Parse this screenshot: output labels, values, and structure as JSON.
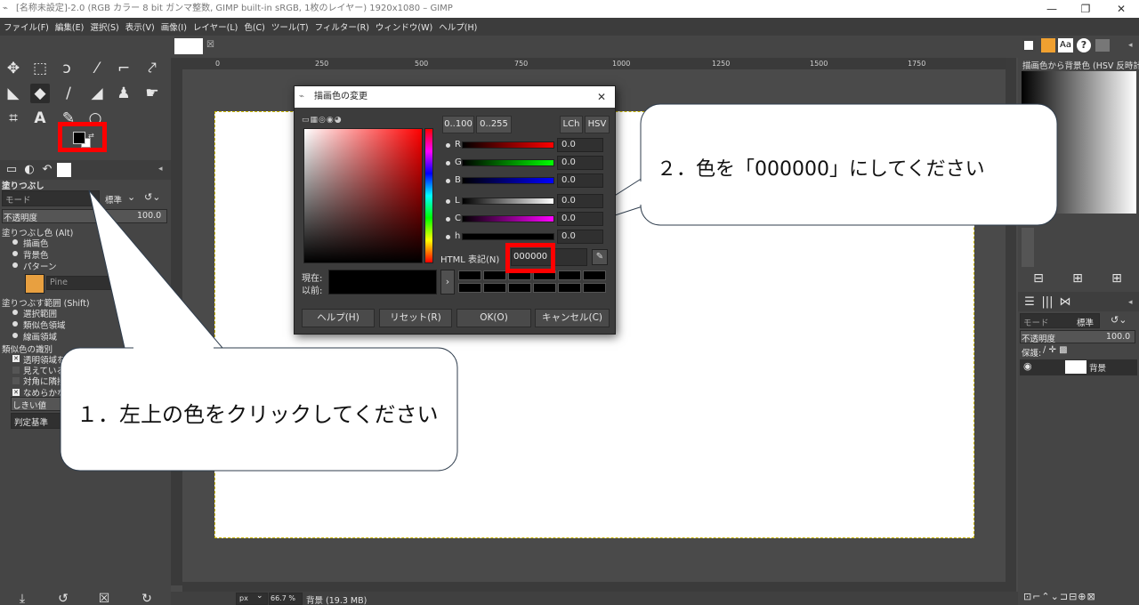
{
  "window": {
    "title": "[名称未設定]-2.0 (RGB カラー 8 bit ガンマ整数, GIMP built-in sRGB, 1枚のレイヤー) 1920x1080 – GIMP",
    "minimize": "—",
    "maximize": "❐",
    "close": "✕"
  },
  "menu": [
    "ファイル(F)",
    "編集(E)",
    "選択(S)",
    "表示(V)",
    "画像(I)",
    "レイヤー(L)",
    "色(C)",
    "ツール(T)",
    "フィルター(R)",
    "ウィンドウ(W)",
    "ヘルプ(H)"
  ],
  "toolbox": {
    "tool_options_title": "塗りつぶし",
    "mode_label": "モード",
    "mode_value": "標準",
    "opacity_label": "不透明度",
    "opacity_value": "100.0",
    "fill_color_label": "塗りつぶし色 (Alt)",
    "fill_options": [
      "描画色",
      "背景色",
      "パターン"
    ],
    "pattern_name": "Pine",
    "area_label": "塗りつぶす範囲 (Shift)",
    "area_options": [
      "選択範囲",
      "類似色領域",
      "線画領域"
    ],
    "similar_label": "類似色の識別",
    "similar_options": [
      "透明領域を",
      "見えている",
      "対角に隣接",
      "なめらかな"
    ],
    "threshold_label": "しきい値",
    "criterion_label": "判定基準"
  },
  "ruler_ticks": [
    "0",
    "250",
    "500",
    "750",
    "1000",
    "1250",
    "1500",
    "1750"
  ],
  "status": {
    "unit": "px",
    "zoom": "66.7 %",
    "info": "背景 (19.3 MB)"
  },
  "dialog": {
    "title": "描画色の変更",
    "range_buttons": [
      "0..100",
      "0..255"
    ],
    "mode_buttons": [
      "LCh",
      "HSV"
    ],
    "sliders": [
      {
        "label": "R",
        "value": "0.0"
      },
      {
        "label": "G",
        "value": "0.0"
      },
      {
        "label": "B",
        "value": "0.0"
      },
      {
        "label": "L",
        "value": "0.0"
      },
      {
        "label": "C",
        "value": "0.0"
      },
      {
        "label": "h",
        "value": "0.0"
      }
    ],
    "html_label": "HTML 表記(N)",
    "html_value": "000000",
    "current_label": "現在:",
    "previous_label": "以前:",
    "buttons": [
      "ヘルプ(H)",
      "リセット(R)",
      "OK(O)",
      "キャンセル(C)"
    ],
    "colors": {
      "red": "#ff0000",
      "green": "#00ff00",
      "blue": "#0000ff",
      "cyan": "#ff00ff"
    }
  },
  "right_panel": {
    "gradient_name": "描画色から背景色 (HSV 反時計",
    "layers_mode_label": "モード",
    "layers_mode_value": "標準",
    "layers_opacity_label": "不透明度",
    "layers_opacity_value": "100.0",
    "lock_label": "保護:",
    "layer_name": "背景"
  },
  "callouts": {
    "step1": "１．左上の色をクリックしてください",
    "step2": "２．色を「000000」にしてください"
  },
  "colors": {
    "highlight": "#ff0000",
    "panel": "#454545",
    "canvas_border": "#c8b400"
  }
}
